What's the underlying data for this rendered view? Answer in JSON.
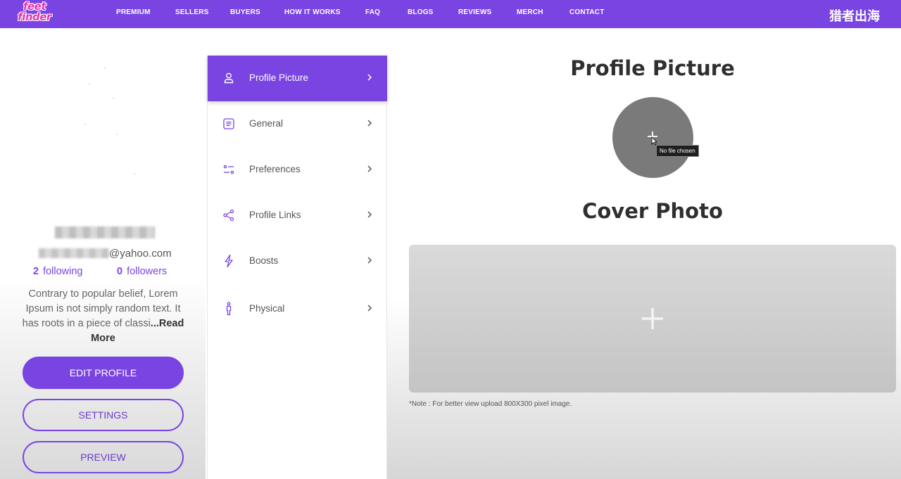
{
  "brand": {
    "logo_line1": "feet",
    "logo_line2": "finder",
    "watermark": "猎者出海"
  },
  "nav": [
    {
      "label": "PREMIUM"
    },
    {
      "label": "SELLERS"
    },
    {
      "label": "BUYERS"
    },
    {
      "label": "HOW IT WORKS"
    },
    {
      "label": "FAQ"
    },
    {
      "label": "BLOGS"
    },
    {
      "label": "REVIEWS"
    },
    {
      "label": "MERCH"
    },
    {
      "label": "CONTACT"
    }
  ],
  "profile": {
    "email_suffix": "@yahoo.com",
    "following_count": "2",
    "following_label": "following",
    "followers_count": "0",
    "followers_label": "followers",
    "bio": "Contrary to popular belief, Lorem Ipsum is not simply random text. It has roots in a piece of classi",
    "read_more": "...Read More",
    "buttons": {
      "edit": "EDIT PROFILE",
      "settings": "SETTINGS",
      "preview": "PREVIEW"
    }
  },
  "menu": [
    {
      "label": "Profile Picture",
      "icon": "user-icon",
      "active": true
    },
    {
      "label": "General",
      "icon": "document-icon",
      "active": false
    },
    {
      "label": "Preferences",
      "icon": "sliders-icon",
      "active": false
    },
    {
      "label": "Profile Links",
      "icon": "share-icon",
      "active": false
    },
    {
      "label": "Boosts",
      "icon": "lightning-icon",
      "active": false
    },
    {
      "label": "Physical",
      "icon": "person-icon",
      "active": false
    }
  ],
  "main": {
    "profile_picture_title": "Profile Picture",
    "tooltip": "No file chosen",
    "cover_title": "Cover Photo",
    "note": "*Note : For better view upload 800X300 pixel image."
  },
  "colors": {
    "accent": "#7a44e2",
    "logo_pink": "#e236b0"
  }
}
